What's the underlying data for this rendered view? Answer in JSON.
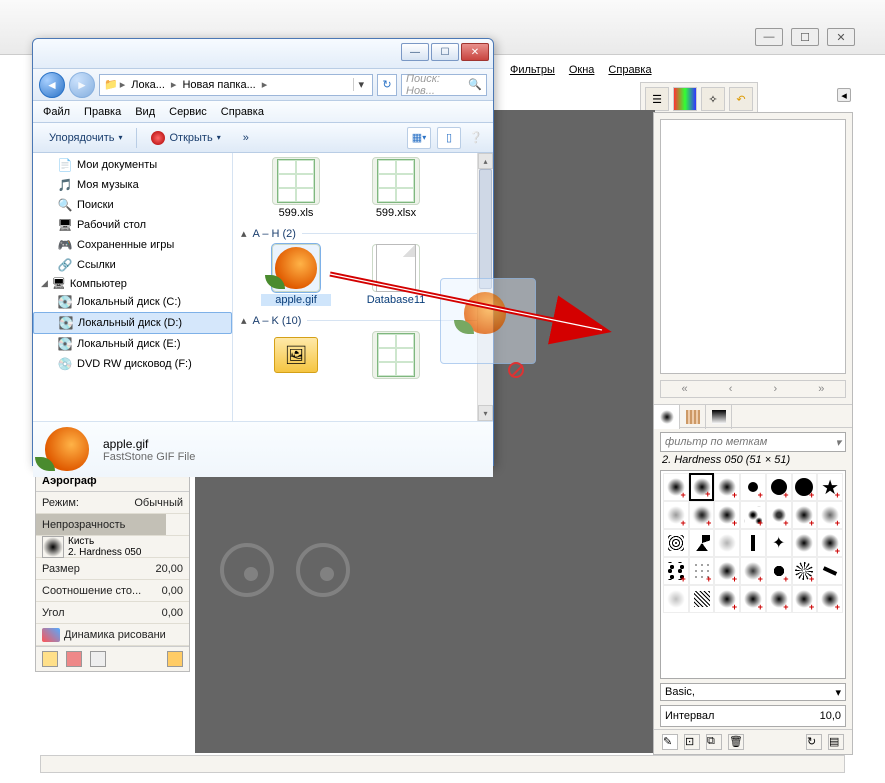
{
  "gimp": {
    "menubar": [
      "Фильтры",
      "Окна",
      "Справка"
    ],
    "win_buttons": {
      "min": "—",
      "max": "☐",
      "close": "✕"
    },
    "tool_options": {
      "title": "Аэрограф",
      "mode_label": "Режим:",
      "mode_value": "Обычный",
      "opacity_label": "Непрозрачность",
      "brush_label": "Кисть",
      "brush_name": "2. Hardness 050",
      "size_label": "Размер",
      "size_value": "20,00",
      "ratio_label": "Соотношение сто...",
      "ratio_value": "0,00",
      "angle_label": "Угол",
      "angle_value": "0,00",
      "dynamics_label": "Динамика рисовани"
    },
    "right_dock": {
      "filter_placeholder": "фильтр по меткам",
      "brush_info": "2. Hardness 050 (51 × 51)",
      "preset": "Basic,",
      "spacing_label": "Интервал",
      "spacing_value": "10,0"
    }
  },
  "explorer": {
    "win_buttons": {
      "min": "—",
      "max": "☐",
      "close": "✕"
    },
    "nav": {
      "back": "◄",
      "fwd": "►",
      "segments": [
        "Лока...",
        "Новая папка..."
      ],
      "arrow": "▸",
      "drop": "▾",
      "refresh": "↻",
      "search_placeholder": "Поиск: Нов...",
      "search_icon": "🔍"
    },
    "menubar": [
      "Файл",
      "Правка",
      "Вид",
      "Сервис",
      "Справка"
    ],
    "toolbar": {
      "organize": "Упорядочить",
      "open": "Открыть",
      "more": "»",
      "dd": "▾"
    },
    "tree": [
      {
        "icon": "📄",
        "label": "Мои документы"
      },
      {
        "icon": "🎵",
        "label": "Моя музыка"
      },
      {
        "icon": "🔍",
        "label": "Поиски"
      },
      {
        "icon": "🖥",
        "label": "Рабочий стол"
      },
      {
        "icon": "🎮",
        "label": "Сохраненные игры"
      },
      {
        "icon": "🔗",
        "label": "Ссылки"
      }
    ],
    "tree_comp_label": "Компьютер",
    "tree_drives": [
      {
        "icon": "💽",
        "label": "Локальный диск (C:)"
      },
      {
        "icon": "💽",
        "label": "Локальный диск (D:)",
        "selected": true
      },
      {
        "icon": "💽",
        "label": "Локальный диск (E:)"
      },
      {
        "icon": "💿",
        "label": "DVD RW дисковод (F:)"
      }
    ],
    "content": {
      "top_files": [
        {
          "name": "599.xls"
        },
        {
          "name": "599.xlsx"
        }
      ],
      "group1_label": "A – H (2)",
      "group1_files": [
        {
          "name": "apple.gif",
          "selected": true,
          "type": "apple"
        },
        {
          "name": "Database11",
          "type": "db"
        }
      ],
      "group2_label": "A – K (10)",
      "group2_files": [
        {
          "name": "",
          "type": "folder"
        },
        {
          "name": "",
          "type": "xl"
        }
      ]
    },
    "details": {
      "filename": "apple.gif",
      "filetype": "FastStone GIF File"
    }
  }
}
